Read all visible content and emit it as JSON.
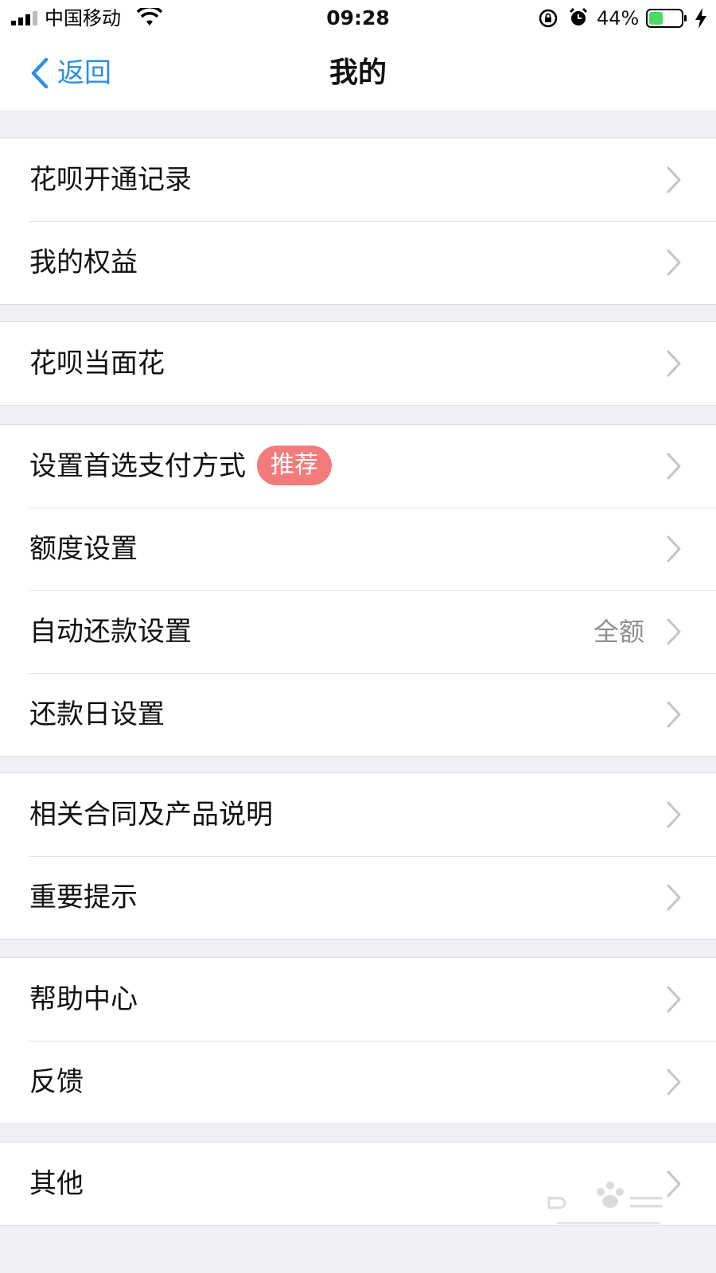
{
  "status_bar": {
    "carrier": "中国移动",
    "time": "09:28",
    "battery_percent": "44%",
    "battery_level": 0.44,
    "battery_color": "#4cd964"
  },
  "nav": {
    "back_label": "返回",
    "title": "我的",
    "accent_color": "#2b8fe6"
  },
  "groups": [
    {
      "rows": [
        {
          "label": "花呗开通记录"
        },
        {
          "label": "我的权益"
        }
      ]
    },
    {
      "rows": [
        {
          "label": "花呗当面花"
        }
      ]
    },
    {
      "rows": [
        {
          "label": "设置首选支付方式",
          "badge": "推荐"
        },
        {
          "label": "额度设置"
        },
        {
          "label": "自动还款设置",
          "value": "全额"
        },
        {
          "label": "还款日设置"
        }
      ]
    },
    {
      "rows": [
        {
          "label": "相关合同及产品说明"
        },
        {
          "label": "重要提示"
        }
      ]
    },
    {
      "rows": [
        {
          "label": "帮助中心"
        },
        {
          "label": "反馈"
        }
      ]
    },
    {
      "rows": [
        {
          "label": "其他"
        }
      ]
    }
  ],
  "watermark": {
    "text": "Baidu经验",
    "subtext": "jingyan.baidu.com"
  }
}
